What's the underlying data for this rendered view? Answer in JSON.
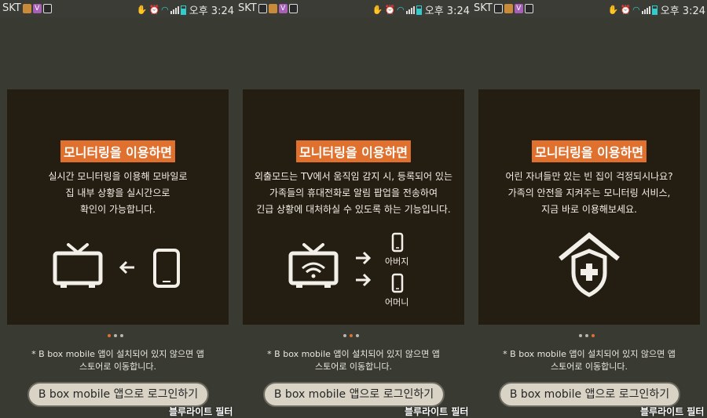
{
  "status_bar": {
    "carrier": "SKT",
    "time": "오후 3:24"
  },
  "panels": [
    {
      "title": "모니터링을 이용하면",
      "description": [
        "실시간 모니터링을 이용해  모바일로",
        "집 내부 상황을 실시간으로",
        "확인이 가능합니다."
      ],
      "illustration_icons": [
        "tv-icon",
        "arrow-left-icon",
        "phone-icon"
      ],
      "page_index": 0
    },
    {
      "title": "모니터링을 이용하면",
      "description": [
        "외출모드는 TV에서 움직임 감지 시, 등록되어 있는",
        "가족들의 휴대전화로 알림 팝업을 전송하여",
        "긴급 상황에 대처하실 수 있도록 하는 기능입니다."
      ],
      "recipients": [
        "아버지",
        "어머니"
      ],
      "illustration_icons": [
        "tv-wifi-icon",
        "arrow-right-icon",
        "phone-icon"
      ],
      "page_index": 1
    },
    {
      "title": "모니터링을 이용하면",
      "description": [
        "어린 자녀들만 있는 빈 집이 걱정되시나요?",
        "가족의 안전을 지켜주는 모니터링 서비스,",
        "지금 바로 이용해보세요."
      ],
      "illustration_icons": [
        "home-shield-icon"
      ],
      "page_index": 2
    }
  ],
  "note": [
    "* B box mobile 앱이 설치되어 있지 않으면 앱",
    "스토어로 이동합니다."
  ],
  "login_button": "B box mobile 앱으로 로그인하기",
  "filter_label": "블루라이트 필터",
  "pager_count": 3,
  "colors": {
    "accent": "#e0702e",
    "card_bg": "#241d12",
    "page_bg": "#393b33",
    "button_bg": "#d8d3c4"
  }
}
